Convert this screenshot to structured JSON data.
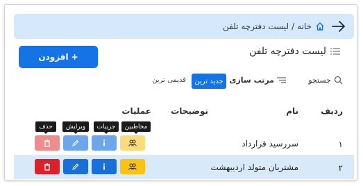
{
  "breadcrumb": {
    "home": "خانه",
    "separator": "/",
    "current": "لیست دفترچه تلفن"
  },
  "page": {
    "title": "لیست دفترچه تلفن"
  },
  "add_button": {
    "icon": "+",
    "label": "افزودن"
  },
  "toolbar": {
    "search_label": "جستجو",
    "sort_label": "مرتب سازی",
    "sort_newest": "جدید ترین",
    "sort_oldest": "قدیمی ترین"
  },
  "table": {
    "headers": {
      "index": "ردیف",
      "name": "نام",
      "description": "توضیحات",
      "operations": "عملیات"
    },
    "rows": [
      {
        "index": "۱",
        "name": "سررسید قرارداد",
        "description": ""
      },
      {
        "index": "۲",
        "name": "مشتریان متولد اردیبهشت",
        "description": ""
      }
    ]
  },
  "tooltips": {
    "contacts": "مخاطبین",
    "details": "جزییات",
    "edit": "ویرایش",
    "delete": "حذف"
  },
  "icons": {
    "home": "home-icon",
    "back": "arrow-right-icon",
    "list": "list-icon",
    "search": "search-icon",
    "sort": "sort-icon",
    "contacts": "users-icon",
    "details": "info-icon",
    "edit": "pencil-icon",
    "delete": "trash-icon"
  },
  "colors": {
    "accent": "#1673e6",
    "banner": "#d6e8fb",
    "selected_row": "#d8e9fa",
    "contacts": "#f9c315",
    "details": "#1a6fd8",
    "edit": "#1a6fd8",
    "delete": "#d9232c"
  }
}
